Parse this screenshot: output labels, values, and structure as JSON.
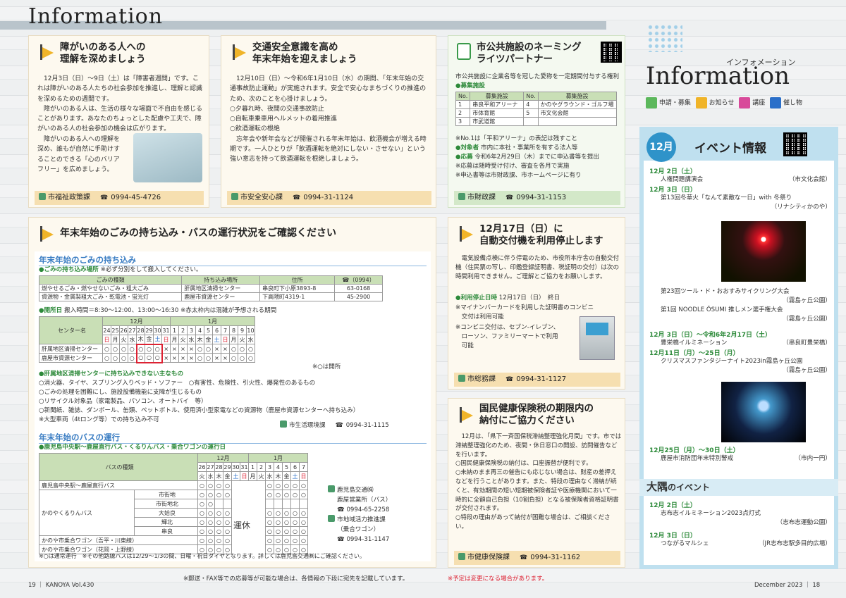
{
  "header": {
    "title": "Information"
  },
  "c1": {
    "title_1": "障がいのある人への",
    "title_2": "理解を深めましょう",
    "body": "　12月3日（日）～9日（土）は「障害者週間」です。これは障がいのある人たちの社会参加を推進し、理解と認識を深めるための週間です。\n　障がいのある人は、生活の様々な場面で不自由を感じることがあります。あなたのちょっとした配慮や工夫で、障がいのある人の社会参加の機会は広がります。",
    "body2": "　障がいのある人への理解を\n深め、誰もが自然に手助けす\nることのできる「心のバリア\nフリー」を広めましょう。",
    "dept": "市福祉政策課",
    "tel": "0994-45-4726"
  },
  "c2": {
    "title_1": "交通安全意識を高め",
    "title_2": "年末年始を迎えましょう",
    "body": "　12月10日（日）～令和6年1月10日（水）の期間、「年末年始の交通事故防止運動」が実施されます。安全で安心なまちづくりの推進のため、次のことを心掛けましょう。\n○夕暮れ時、夜間の交通事故防止\n○自転車乗車用ヘルメットの着用推進\n○飲酒運転の根絶\n　忘年会や新年会などが開催される年末年始は、飲酒機会が増える時期です。一人ひとりが「飲酒運転を絶対にしない・させない」という強い意志を持って飲酒運転を根絶しましょう。",
    "dept": "市安全安心課",
    "tel": "0994-31-1124"
  },
  "c3": {
    "title_1": "市公共施設のネーミング",
    "title_2": "ライツパートナー",
    "intro": "市公共施設に企業名等を冠した愛称を一定期間付与する権利",
    "recruit": "●募集施設",
    "table_head": [
      "No.",
      "募集施設",
      "No.",
      "募集施設"
    ],
    "rows": [
      [
        "1",
        "串良平和アリーナ",
        "4",
        "かのやグラウンド・ゴルフ場"
      ],
      [
        "2",
        "市体育館",
        "5",
        "市文化会館"
      ],
      [
        "3",
        "市武道館",
        "",
        ""
      ]
    ],
    "note1": "※No.1は「平和アリーナ」の表記は残すこと",
    "target_l": "●対象者",
    "target": "市内に本社・事業所を有する法人等",
    "apply_l": "●応募",
    "apply": "令和6年2月29日（木）までに申込書等を提出",
    "note2": "※応募は随時受け付け、審査を各月で実施",
    "note3": "※申込書等は市財政課、市ホームページに有り",
    "dept": "市財政課",
    "tel": "0994-31-1153"
  },
  "c4": {
    "title": "年末年始のごみの持ち込み・バスの運行状況をご確認ください",
    "s1": "年末年始のごみの持ち込み",
    "place_l": "●ごみの持ち込み場所",
    "place_note": "※必ず分別をして搬入してください。",
    "place_head": [
      "ごみの種類",
      "持ち込み場所",
      "住所",
      "☎（0994）"
    ],
    "place_rows": [
      [
        "燃やせるごみ・燃やせないごみ・粗大ごみ",
        "肝属地区清掃センター",
        "串良町下小原3893-8",
        "63-0168"
      ],
      [
        "資源物・金属製粗大ごみ・乾電池・蛍光灯",
        "鹿屋市資源センター",
        "下高隈町4319-1",
        "45-2900"
      ]
    ],
    "open_l": "●開所日",
    "open": "搬入時間＝8:30～12:00、13:00～16:30",
    "open_note": "※赤太枠内は混雑が予想される期間",
    "m12": "12月",
    "m1": "1月",
    "center_l": "センター名",
    "days": [
      "24",
      "25",
      "26",
      "27",
      "28",
      "29",
      "30",
      "31",
      "1",
      "2",
      "3",
      "4",
      "5",
      "6",
      "7",
      "8",
      "9",
      "10"
    ],
    "wd": [
      "日",
      "月",
      "火",
      "水",
      "木",
      "金",
      "土",
      "日",
      "月",
      "火",
      "水",
      "木",
      "金",
      "土",
      "日",
      "月",
      "火",
      "水"
    ],
    "g1_name": "肝属地区清掃センター",
    "g1": [
      "○",
      "○",
      "○",
      "○",
      "○",
      "○",
      "○",
      "×",
      "×",
      "×",
      "×",
      "○",
      "○",
      "×",
      "×",
      "○",
      "○",
      "○"
    ],
    "g2_name": "鹿屋市資源センター",
    "g2": [
      "○",
      "○",
      "○",
      "○",
      "○",
      "○",
      "○",
      "×",
      "×",
      "×",
      "×",
      "○",
      "○",
      "×",
      "×",
      "○",
      "○",
      "○"
    ],
    "open_mark": "※○は開所",
    "ng_l": "●肝属地区清掃センターに持ち込みできない主なもの",
    "ng": [
      "○消火器、タイヤ、スプリング入りベッド・ソファー　○有害性、危険性、引火性、爆発性のあるもの",
      "○ごみの処理を困難にし、施設設備機能に支障が生じるもの",
      "○リサイクル対象品（家電製品、パソコン、オートバイ　等）",
      "○新聞紙、雑誌、ダンボール、缶類、ペットボトル、使用済小型家電などの資源物（鹿屋市資源センターへ持ち込み）",
      "※大型車両（4tロング等）での持ち込み不可"
    ],
    "dept1": "市生活環境課",
    "tel1": "0994-31-1115",
    "s2": "年末年始のバスの運行",
    "bus_l": "●鹿児島中央駅～鹿屋直行バス・くるりんバス・乗合ワゴンの運行日",
    "bus_head": "バスの種類",
    "bus_m12": "12月",
    "bus_m1": "1月",
    "bus_days": [
      "26",
      "27",
      "28",
      "29",
      "30",
      "31",
      "1",
      "2",
      "3",
      "4",
      "5",
      "6",
      "7"
    ],
    "bus_wd": [
      "火",
      "水",
      "木",
      "金",
      "土",
      "日",
      "月",
      "火",
      "水",
      "木",
      "金",
      "土",
      "日"
    ],
    "bus_rows": [
      "鹿児島中央駅～鹿屋直行バス",
      "かのやくるりんバス",
      "かのや市乗合ワゴン（吾平・川東線）",
      "かのや市乗合ワゴン（花岡・上野線）"
    ],
    "kururin": [
      "市街地",
      "市街地北",
      "大姶良",
      "輝北",
      "串良"
    ],
    "closed": "運休",
    "bus_foot": "※○は通常運行　※その他路線バスは12/29～1/3の間、日曜・祝日ダイヤとなります。詳しくは鹿児島交通㈱にご確認ください。",
    "kagoshima": "鹿児島交通㈱",
    "kagoshima2": "鹿屋営業所（バス）",
    "tel2": "0994-65-2258",
    "chiiki": "市地域活力推進課",
    "chiiki2": "（乗合ワゴン）",
    "tel3": "0994-31-1147"
  },
  "c5": {
    "title_1": "12月17日（日）に",
    "title_2": "自動交付機を利用停止します",
    "body": "　電気設備点検に伴う停電のため、市役所本庁舎の自動交付機（住民票の写し、印鑑登録証明書、税証明の交付）は次の時間利用できません。ご理解とご協力をお願いします。",
    "stop_l": "●利用停止日時",
    "stop": "12月17日（日）　終日",
    "n1": "※マイナンバーカードを利用した証明書のコンビニ\n　交付は利用可能",
    "n2": "※コンビニ交付は、セブン-イレブン、\n　ローソン、ファミリーマートで利用\n　可能",
    "dept": "市総務課",
    "tel": "0994-31-1127"
  },
  "c6": {
    "title_1": "国民健康保険税の期限内の",
    "title_2": "納付にご協力ください",
    "body": "　12月は、「県下一斉国保税滞納整理強化月間」です。市では滞納整理強化のため、夜間・休日窓口の開設、訪問催告などを行います。\n○国民健康保険税の納付は、口座振替が便利です。\n○未納のまま再三の催告にも応じない場合は、財産の差押えなどを行うことがあります。また、特段の理由なく滞納が続くと、有効期間の短い短期被保険者証や医療機関において一時的に全額自己負担（10割負担）となる被保険者資格証明書が交付されます。\n○特段の理由があって納付が困難な場合は、ご相談ください。",
    "dept": "市健康保険課",
    "tel": "0994-31-1162"
  },
  "right": {
    "kana": "インフォメーション",
    "logo": "Information",
    "legend": [
      "申請・募集",
      "お知らせ",
      "講座",
      "催し物"
    ],
    "month": "12月",
    "evt_title": "イベント情報",
    "events": [
      {
        "d": "12月 2日（土）",
        "items": [
          [
            "人権問題講演会",
            "（市文化会館）"
          ]
        ]
      },
      {
        "d": "12月 3日（日）",
        "items": [
          [
            "第13回冬華火「なんて素敵な一日」with 冬祭り",
            ""
          ],
          [
            "",
            "（リナシティかのや）"
          ]
        ]
      }
    ],
    "events2": [
      [
        "第23回ツール・ド・おおすみサイクリング大会",
        ""
      ],
      [
        "",
        "（霧島ヶ丘公園）"
      ],
      [
        "第1回 NOODLE ŌSUMI 推しメン選手権大会",
        ""
      ],
      [
        "",
        "（霧島ヶ丘公園）"
      ]
    ],
    "d3": "12月 3日（日）～令和6年2月17日（土）",
    "e3": [
      "豊栄橋イルミネーション",
      "（串良町豊栄橋）"
    ],
    "d4": "12月11日（月）～25日（月）",
    "e4": [
      "クリスマスファンタジーナイト2023in霧島ヶ丘公園",
      "（霧島ヶ丘公園）"
    ],
    "d5": "12月25日（月）～30日（土）",
    "e5": [
      "鹿屋市消防団年末特別警戒",
      "（市内一円）"
    ],
    "osumi": "大隅",
    "osumi2": "のイベント",
    "d6": "12月 2日（土）",
    "e6": [
      "志布志イルミネーション2023点灯式",
      "（志布志運動公園）"
    ],
    "d7": "12月 3日（日）",
    "e7": [
      "つながるマルシェ",
      "（JR志布志駅多目的広場）"
    ]
  },
  "footer": {
    "left": "19 ｜ KANOYA Vol.430",
    "center": "※郵送・FAX等での応募等が可能な場合は、各情報の下段に宛先を記載しています。",
    "change": "※予定は変更になる場合があります。",
    "right": "December 2023 ｜ 18"
  }
}
